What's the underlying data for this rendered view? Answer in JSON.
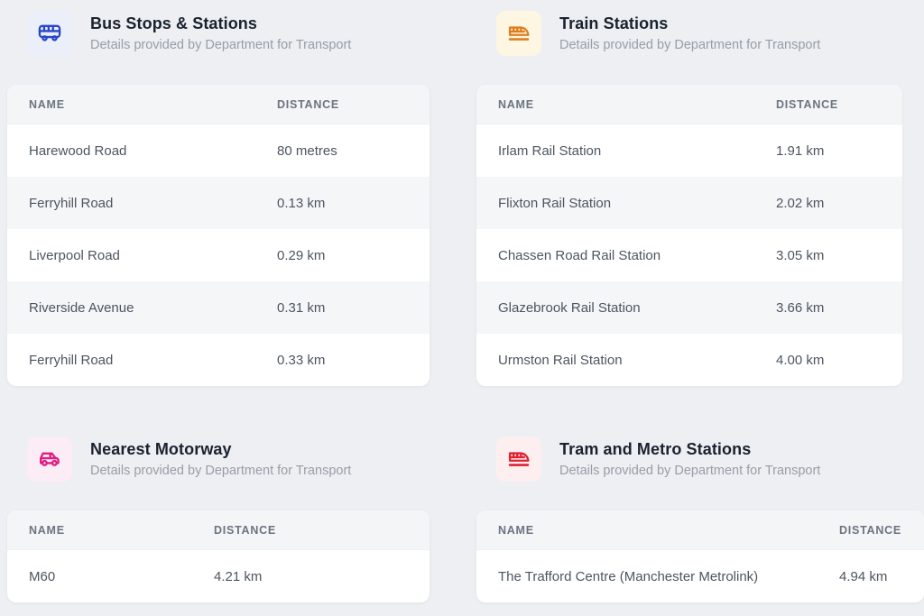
{
  "page": {
    "background": "#edeff2"
  },
  "sections": [
    {
      "id": "bus",
      "title": "Bus Stops & Stations",
      "subtitle": "Details provided by Department for Transport",
      "icon": "bus-icon",
      "icon_color": "#2946c8",
      "icon_bg": "#ebeffa",
      "columns": [
        "NAME",
        "DISTANCE"
      ],
      "rows": [
        [
          "Harewood Road",
          "80 metres"
        ],
        [
          "Ferryhill Road",
          "0.13 km"
        ],
        [
          "Liverpool Road",
          "0.29 km"
        ],
        [
          "Riverside Avenue",
          "0.31 km"
        ],
        [
          "Ferryhill Road",
          "0.33 km"
        ]
      ]
    },
    {
      "id": "train",
      "title": "Train Stations",
      "subtitle": "Details provided by Department for Transport",
      "icon": "train-icon",
      "icon_color": "#e07e1e",
      "icon_bg": "#fcf6e2",
      "columns": [
        "NAME",
        "DISTANCE"
      ],
      "rows": [
        [
          "Irlam Rail Station",
          "1.91 km"
        ],
        [
          "Flixton Rail Station",
          "2.02 km"
        ],
        [
          "Chassen Road Rail Station",
          "3.05 km"
        ],
        [
          "Glazebrook Rail Station",
          "3.66 km"
        ],
        [
          "Urmston Rail Station",
          "4.00 km"
        ]
      ]
    },
    {
      "id": "motorway",
      "title": "Nearest Motorway",
      "subtitle": "Details provided by Department for Transport",
      "icon": "car-icon",
      "icon_color": "#df1c7f",
      "icon_bg": "#fcecf5",
      "columns": [
        "NAME",
        "DISTANCE"
      ],
      "rows": [
        [
          "M60",
          "4.21 km"
        ]
      ]
    },
    {
      "id": "tram",
      "title": "Tram and Metro Stations",
      "subtitle": "Details provided by Department for Transport",
      "icon": "tram-icon",
      "icon_color": "#df2233",
      "icon_bg": "#fdeff0",
      "columns": [
        "NAME",
        "DISTANCE"
      ],
      "rows": [
        [
          "The Trafford Centre (Manchester Metrolink)",
          "4.94 km"
        ]
      ]
    }
  ]
}
